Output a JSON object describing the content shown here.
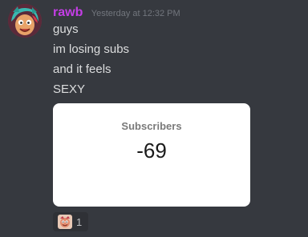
{
  "message": {
    "username": "rawb",
    "username_color": "#c43ee6",
    "timestamp": "Yesterday at 12:32 PM",
    "avatar": "cartoon-avatar-icon",
    "lines": [
      "guys",
      "im losing subs",
      "and it feels",
      "SEXY"
    ],
    "embed": {
      "label": "Subscribers",
      "value": "-69"
    },
    "reaction": {
      "emoji": "cartoon-face-emoji-icon",
      "count": "1"
    }
  },
  "colors": {
    "background": "#36393f",
    "text": "#dcddde",
    "muted": "#72767d",
    "reaction_bg": "#2f3136"
  }
}
